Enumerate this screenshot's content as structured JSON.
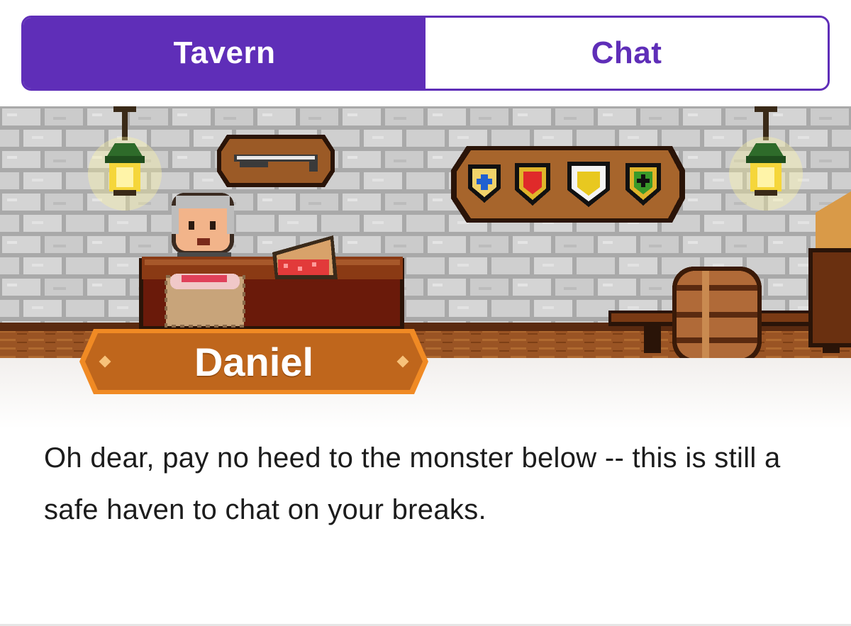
{
  "tabs": {
    "items": [
      {
        "label": "Tavern",
        "active": true
      },
      {
        "label": "Chat",
        "active": false
      }
    ]
  },
  "scene": {
    "npc_name": "Daniel",
    "objects": [
      "lantern-icon",
      "hanging-sword-plaque",
      "shields-plaque",
      "innkeeper-avatar",
      "pie",
      "counter",
      "barrel",
      "bench",
      "lantern-icon"
    ]
  },
  "dialog": {
    "text": "Oh dear, pay no heed to the monster below -- this is still a safe haven to chat on your breaks."
  },
  "colors": {
    "accent": "#5f2eb8",
    "nameplate": "#c0661a",
    "nameplate_border": "#f08a24",
    "wall": "#bdbdbd",
    "wood": "#8a4a1c"
  }
}
